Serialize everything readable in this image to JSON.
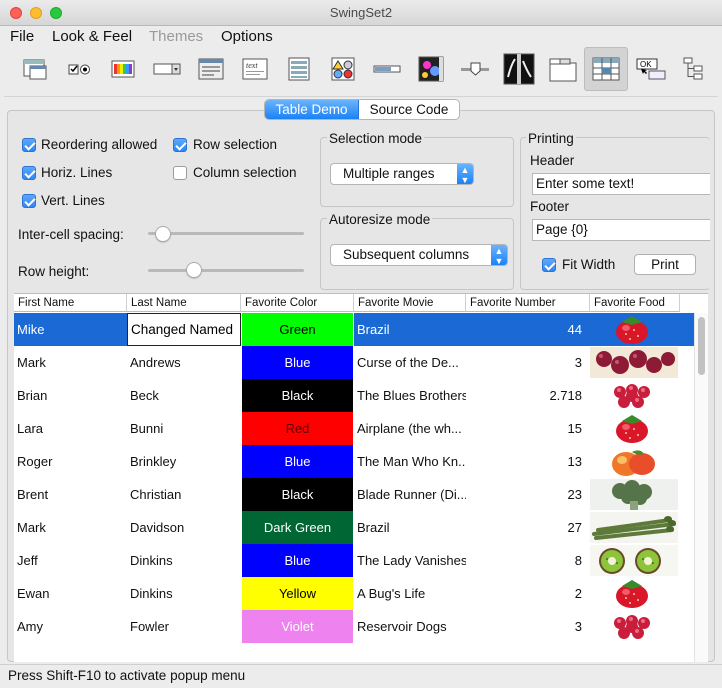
{
  "window": {
    "title": "SwingSet2"
  },
  "menu": [
    "File",
    "Look & Feel",
    "Themes",
    "Options"
  ],
  "toolbar_icons": [
    "internal-frame-demo-icon",
    "button-demo-icon",
    "color-chooser-demo-icon",
    "combobox-demo-icon",
    "file-chooser-demo-icon",
    "html-editor-demo-icon",
    "list-demo-icon",
    "option-pane-demo-icon",
    "progress-bar-demo-icon",
    "scroll-pane-demo-icon",
    "slider-demo-icon",
    "split-pane-demo-icon",
    "tabbed-pane-demo-icon",
    "table-demo-icon",
    "tooltip-demo-icon",
    "tree-demo-icon"
  ],
  "tabs": {
    "table": "Table Demo",
    "source": "Source Code"
  },
  "options": {
    "reordering": "Reordering allowed",
    "horiz_lines": "Horiz. Lines",
    "vert_lines": "Vert. Lines",
    "row_selection": "Row selection",
    "column_selection": "Column selection",
    "intercell_spacing": "Inter-cell spacing:",
    "row_height": "Row height:"
  },
  "selection_mode": {
    "title": "Selection mode",
    "value": "Multiple ranges"
  },
  "autoresize_mode": {
    "title": "Autoresize mode",
    "value": "Subsequent columns"
  },
  "printing": {
    "title": "Printing",
    "header_label": "Header",
    "header_value": "Enter some text!",
    "footer_label": "Footer",
    "footer_value": "Page {0}",
    "fit_width": "Fit Width",
    "print_button": "Print"
  },
  "table": {
    "columns": [
      "First Name",
      "Last Name",
      "Favorite Color",
      "Favorite Movie",
      "Favorite Number",
      "Favorite Food"
    ],
    "rows": [
      {
        "first": "Mike",
        "last": "Changed Named",
        "color": "Green",
        "bg": "#00ff00",
        "fg": "#000000",
        "movie": "Brazil",
        "number": "44",
        "food": "strawberry"
      },
      {
        "first": "Mark",
        "last": "Andrews",
        "color": "Blue",
        "bg": "#0000ff",
        "fg": "#ffffff",
        "movie": "Curse of the De...",
        "number": "3",
        "food": "grapes"
      },
      {
        "first": "Brian",
        "last": "Beck",
        "color": "Black",
        "bg": "#000000",
        "fg": "#ffffff",
        "movie": "The Blues Brothers",
        "number": "2.718",
        "food": "raspberry"
      },
      {
        "first": "Lara",
        "last": "Bunni",
        "color": "Red",
        "bg": "#ff0000",
        "fg": "#5a0000",
        "movie": "Airplane (the wh...",
        "number": "15",
        "food": "strawberry"
      },
      {
        "first": "Roger",
        "last": "Brinkley",
        "color": "Blue",
        "bg": "#0000ff",
        "fg": "#ffffff",
        "movie": "The Man Who Kn...",
        "number": "13",
        "food": "peach"
      },
      {
        "first": "Brent",
        "last": "Christian",
        "color": "Black",
        "bg": "#000000",
        "fg": "#ffffff",
        "movie": "Blade Runner (Di...",
        "number": "23",
        "food": "broccoli"
      },
      {
        "first": "Mark",
        "last": "Davidson",
        "color": "Dark Green",
        "bg": "#006633",
        "fg": "#ffffff",
        "movie": "Brazil",
        "number": "27",
        "food": "asparagus"
      },
      {
        "first": "Jeff",
        "last": "Dinkins",
        "color": "Blue",
        "bg": "#0000ff",
        "fg": "#ffffff",
        "movie": "The Lady Vanishes",
        "number": "8",
        "food": "kiwi"
      },
      {
        "first": "Ewan",
        "last": "Dinkins",
        "color": "Yellow",
        "bg": "#ffff00",
        "fg": "#000000",
        "movie": "A Bug's Life",
        "number": "2",
        "food": "strawberry"
      },
      {
        "first": "Amy",
        "last": "Fowler",
        "color": "Violet",
        "bg": "#ee82ee",
        "fg": "#ffffff",
        "movie": "Reservoir Dogs",
        "number": "3",
        "food": "raspberry"
      }
    ]
  },
  "status": "Press Shift-F10 to activate popup menu"
}
